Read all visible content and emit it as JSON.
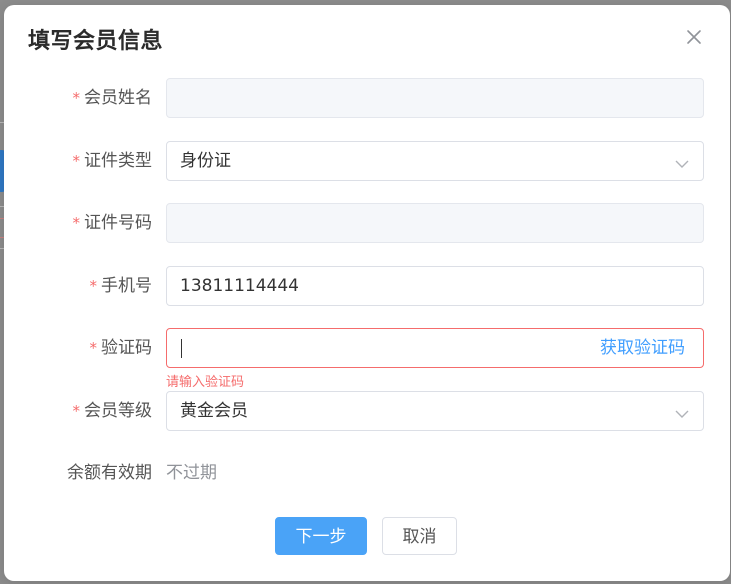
{
  "dialog": {
    "title": "填写会员信息",
    "close_icon": "close-icon"
  },
  "form": {
    "required_mark": "*",
    "member_name": {
      "label": "会员姓名",
      "value": "",
      "disabled": true
    },
    "id_type": {
      "label": "证件类型",
      "value": "身份证",
      "icon": "chevron-down-icon"
    },
    "id_number": {
      "label": "证件号码",
      "value": "",
      "disabled": true
    },
    "phone": {
      "label": "手机号",
      "value": "13811114444"
    },
    "sms_code": {
      "label": "验证码",
      "value": "",
      "action_label": "获取验证码",
      "error": "请输入验证码"
    },
    "member_level": {
      "label": "会员等级",
      "value": "黄金会员",
      "icon": "chevron-down-icon"
    },
    "balance_validity": {
      "label": "余额有效期",
      "value": "不过期"
    }
  },
  "buttons": {
    "next_label": "下一步",
    "cancel_label": "取消"
  },
  "colors": {
    "primary": "#4aa3f7",
    "link": "#409eff",
    "error": "#f56c6c",
    "required": "#f56c6c"
  }
}
